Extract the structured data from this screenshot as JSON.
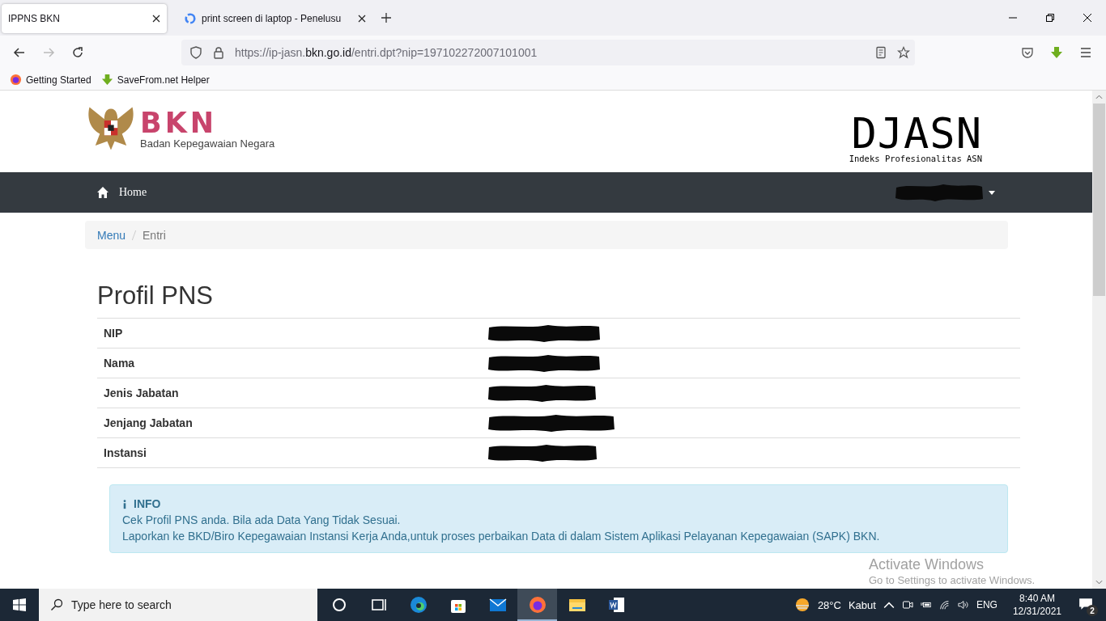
{
  "browser": {
    "tabs": [
      {
        "title": "IPPNS BKN",
        "selected": true,
        "kind": "plain"
      },
      {
        "title": "print screen di laptop - Penelusu",
        "selected": false,
        "kind": "google"
      }
    ],
    "address": {
      "prefix": "https://ip-jasn.",
      "domain": "bkn.go.id",
      "path": "/entri.dpt?nip=197102272007101001"
    },
    "bookmarks": [
      {
        "label": "Getting Started",
        "kind": "firefox"
      },
      {
        "label": "SaveFrom.net Helper",
        "kind": "savefrom"
      }
    ]
  },
  "header": {
    "logo_text": "BKN",
    "logo_subtitle": "Badan Kepegawaian Negara",
    "brand": "DJASN",
    "brand_subtitle": "Indeks Profesionalitas ASN"
  },
  "navbar": {
    "home": "Home"
  },
  "breadcrumb": [
    {
      "label": "Menu",
      "link": true
    },
    {
      "label": "Entri",
      "link": false
    }
  ],
  "profile": {
    "title": "Profil PNS",
    "rows": [
      {
        "label": "NIP"
      },
      {
        "label": "Nama"
      },
      {
        "label": "Jenis Jabatan"
      },
      {
        "label": "Jenjang Jabatan"
      },
      {
        "label": "Instansi"
      }
    ]
  },
  "info": {
    "heading": "INFO",
    "lines": [
      "Cek Profil PNS anda. Bila ada Data Yang Tidak Sesuai.",
      "Laporkan ke BKD/Biro Kepegawaian Instansi Kerja Anda,untuk proses perbaikan Data di dalam Sistem Aplikasi Pelayanan Kepegawaian (SAPK) BKN."
    ]
  },
  "activation": {
    "title": "Activate Windows",
    "subtitle": "Go to Settings to activate Windows."
  },
  "taskbar": {
    "search_placeholder": "Type here to search",
    "weather": "28°C",
    "weather_text": "Kabut",
    "language": "ENG",
    "time": "8:40 AM",
    "date": "12/31/2021",
    "notifications": "2",
    "apps": [
      {
        "kind": "cortana",
        "selected": false
      },
      {
        "kind": "taskview",
        "selected": false
      },
      {
        "kind": "edge",
        "selected": false
      },
      {
        "kind": "store",
        "selected": false
      },
      {
        "kind": "mail",
        "selected": false
      },
      {
        "kind": "firefox",
        "selected": true
      },
      {
        "kind": "explorer",
        "selected": false
      },
      {
        "kind": "word",
        "selected": false
      }
    ]
  }
}
